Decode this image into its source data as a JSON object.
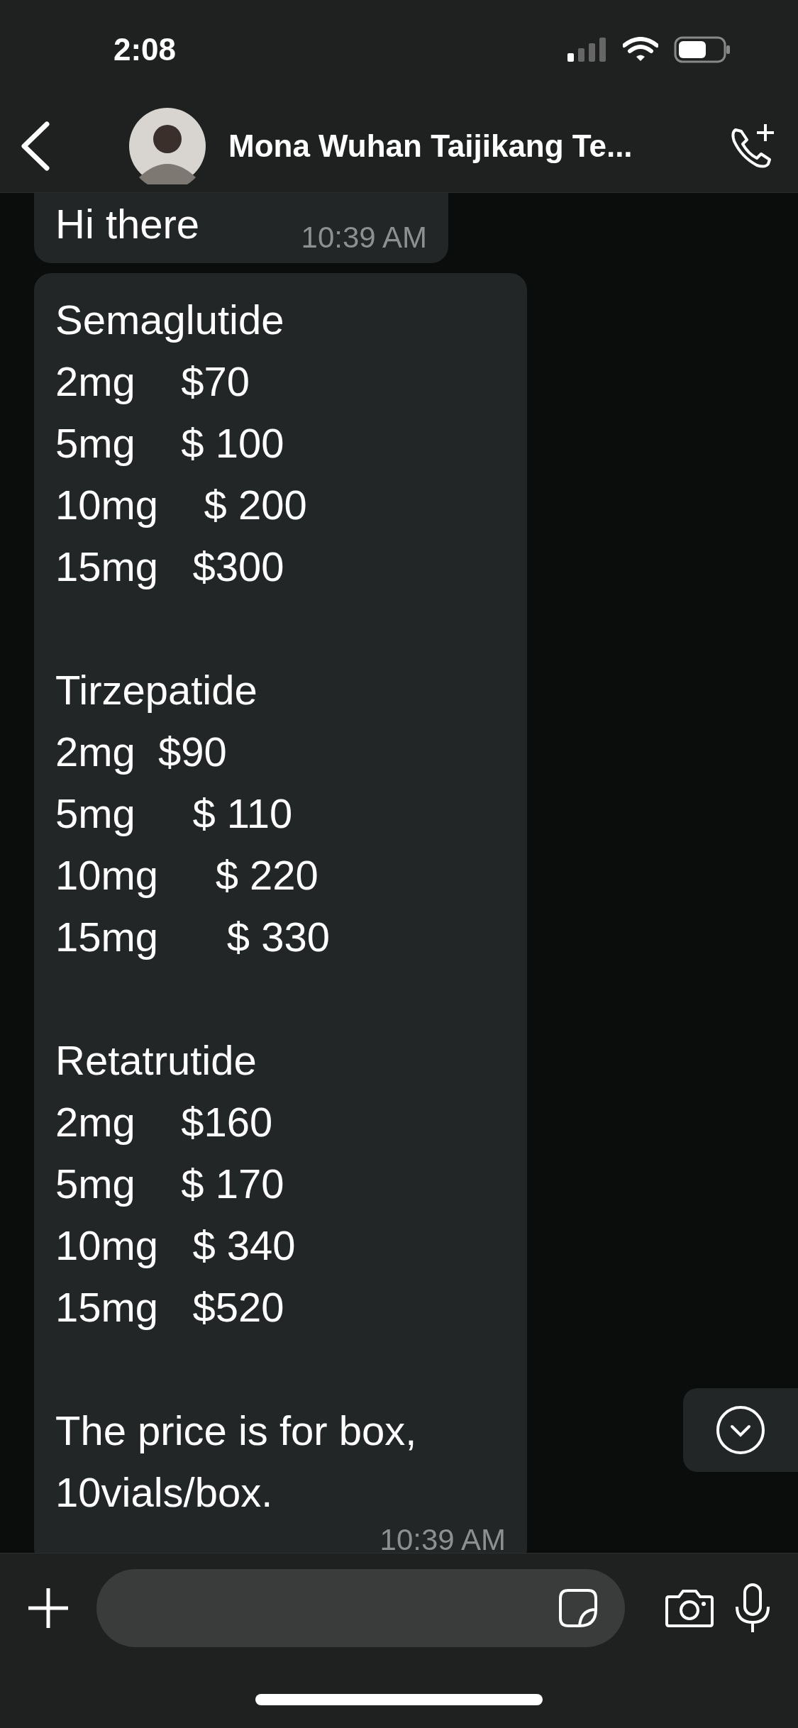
{
  "status_bar": {
    "time": "2:08"
  },
  "header": {
    "title": "Mona Wuhan Taijikang Te..."
  },
  "messages": [
    {
      "paragraphs": [
        [
          "Hi there"
        ]
      ],
      "time": "10:39 AM"
    },
    {
      "paragraphs": [
        [
          "Semaglutide",
          "2mg    $70",
          "5mg    $ 100",
          "10mg    $ 200",
          "15mg   $300"
        ],
        [
          "Tirzepatide",
          "2mg  $90",
          "5mg     $ 110",
          "10mg     $ 220",
          "15mg      $ 330"
        ],
        [
          "Retatrutide",
          "2mg    $160",
          "5mg    $ 170",
          "10mg   $ 340",
          "15mg   $520"
        ],
        [
          "The price is for box, 10vials/box."
        ]
      ],
      "time": "10:39 AM"
    }
  ]
}
